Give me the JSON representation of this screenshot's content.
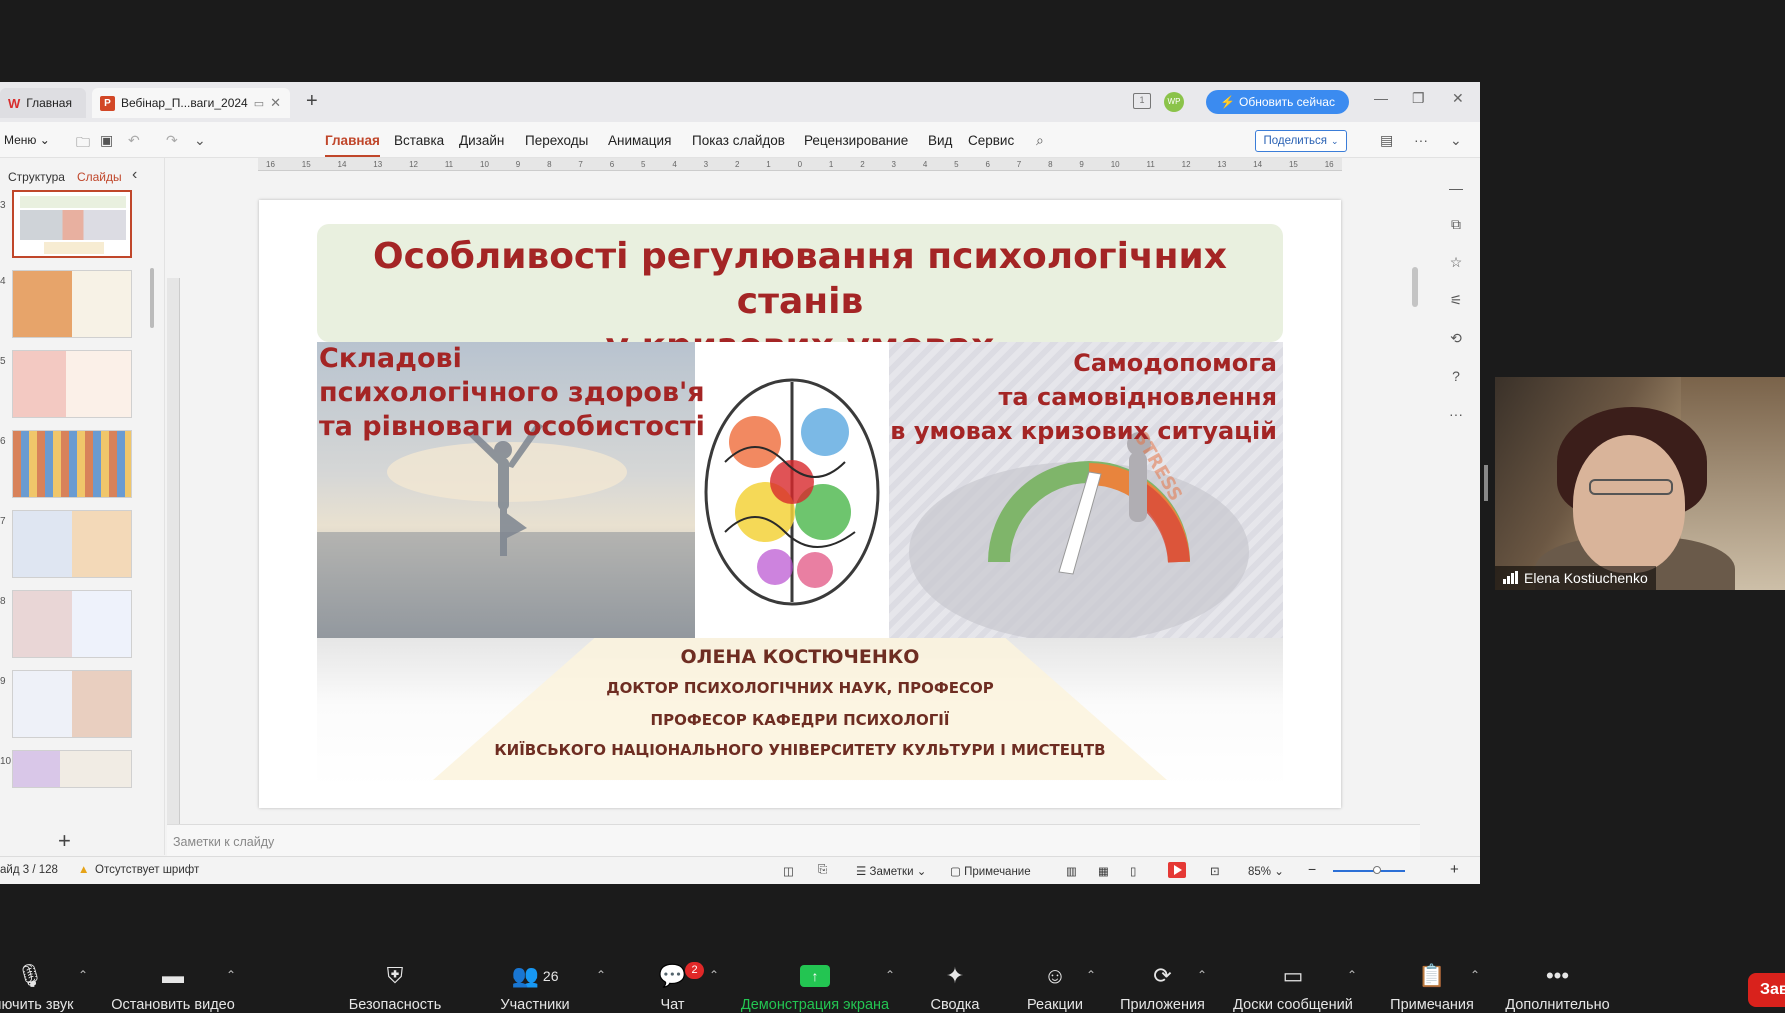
{
  "wps": {
    "tabs": {
      "home": "Главная",
      "doc": "Вебінар_П...ваги_2024"
    },
    "user_initials": "WP",
    "update_button": "Обновить сейчас",
    "menu_label": "Меню",
    "ribbon": [
      "Главная",
      "Вставка",
      "Дизайн",
      "Переходы",
      "Анимация",
      "Показ слайдов",
      "Рецензирование",
      "Вид",
      "Сервис"
    ],
    "share_button": "Поделиться",
    "panel_tabs": {
      "structure": "Структура",
      "slides": "Слайды"
    },
    "thumb_numbers": [
      "3",
      "4",
      "5",
      "6",
      "7",
      "8",
      "9",
      "10"
    ],
    "ruler_numbers": [
      "16",
      "15",
      "14",
      "13",
      "12",
      "11",
      "10",
      "9",
      "8",
      "7",
      "6",
      "5",
      "4",
      "3",
      "2",
      "1",
      "0",
      "1",
      "2",
      "3",
      "4",
      "5",
      "6",
      "7",
      "8",
      "9",
      "10",
      "11",
      "12",
      "13",
      "14",
      "15",
      "16"
    ],
    "notes_placeholder": "Заметки к слайду",
    "status": {
      "slide_counter": "айд 3 / 128",
      "missing_font": "Отсутствует шрифт",
      "notes": "Заметки",
      "comment": "Примечание",
      "zoom": "85%"
    }
  },
  "slide": {
    "title_line1": "Особливості регулювання психологічних станів",
    "title_line2": "у кризових умовах",
    "left_line1": "Складові",
    "left_line2": "психологічного здоров'я",
    "left_line3": "та рівноваги особистості",
    "right_line1": "Самодопомога",
    "right_line2": "та самовідновлення",
    "right_line3": "в умовах кризових ситуацій",
    "stress_label": "STRESS",
    "author_name": "ОЛЕНА КОСТЮЧЕНКО",
    "author_degree": "ДОКТОР ПСИХОЛОГІЧНИХ НАУК, ПРОФЕСОР",
    "author_position": "ПРОФЕСОР КАФЕДРИ ПСИХОЛОГІЇ",
    "author_university": "КИЇВСЬКОГО НАЦІОНАЛЬНОГО УНІВЕРСИТЕТУ КУЛЬТУРИ І МИСТЕЦТВ",
    "title_color": "#a42525"
  },
  "participant": {
    "name": "Elena Kostiuchenko"
  },
  "zoom_toolbar": {
    "mute": "ключить звук",
    "video": "Остановить видео",
    "security": "Безопасность",
    "participants": "Участники",
    "participants_count": "26",
    "chat": "Чат",
    "chat_badge": "2",
    "share": "Демонстрация экрана",
    "summary": "Сводка",
    "reactions": "Реакции",
    "apps": "Приложения",
    "whiteboards": "Доски сообщений",
    "notes": "Примечания",
    "more": "Дополнительно",
    "end": "Зав",
    "share_color": "#23c552"
  }
}
